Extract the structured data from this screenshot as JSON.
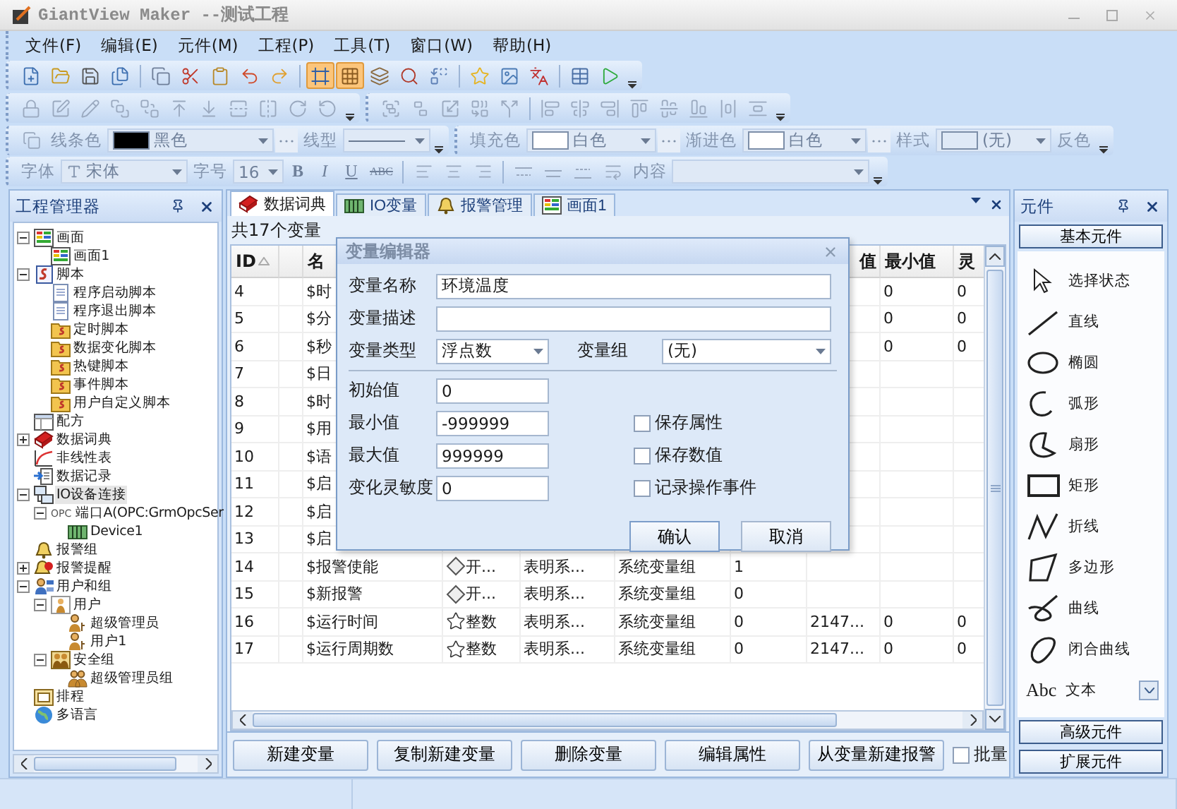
{
  "window": {
    "title": "GiantView Maker --测试工程"
  },
  "menu": [
    "文件(F)",
    "编辑(E)",
    "元件(M)",
    "工程(P)",
    "工具(T)",
    "窗口(W)",
    "帮助(H)"
  ],
  "toolbar_main": [
    {
      "kind": "new",
      "on": false
    },
    {
      "kind": "open",
      "on": false
    },
    {
      "kind": "save",
      "on": false
    },
    {
      "kind": "save-all",
      "on": false
    },
    {
      "kind": "sep"
    },
    {
      "kind": "copy",
      "on": false
    },
    {
      "kind": "cut",
      "on": false
    },
    {
      "kind": "paste",
      "on": false
    },
    {
      "kind": "undo",
      "on": false
    },
    {
      "kind": "redo",
      "on": false
    },
    {
      "kind": "sep"
    },
    {
      "kind": "frame",
      "on": true
    },
    {
      "kind": "grid",
      "on": true
    },
    {
      "kind": "layers",
      "on": false
    },
    {
      "kind": "find",
      "on": false
    },
    {
      "kind": "replace",
      "on": false
    },
    {
      "kind": "sep"
    },
    {
      "kind": "star",
      "on": false
    },
    {
      "kind": "image",
      "on": false
    },
    {
      "kind": "language",
      "on": false
    },
    {
      "kind": "sep"
    },
    {
      "kind": "table",
      "on": false
    },
    {
      "kind": "run",
      "on": false
    }
  ],
  "toolbar_arrange": [
    {
      "kind": "lock"
    },
    {
      "kind": "rect-edit"
    },
    {
      "kind": "pen"
    },
    {
      "kind": "front"
    },
    {
      "kind": "back"
    },
    {
      "kind": "forward"
    },
    {
      "kind": "backward"
    },
    {
      "kind": "flip-v"
    },
    {
      "kind": "flip-h"
    },
    {
      "kind": "rotate-r"
    },
    {
      "kind": "rotate-l"
    }
  ],
  "toolbar_align": [
    {
      "kind": "group"
    },
    {
      "kind": "ungroup"
    },
    {
      "kind": "same-size"
    },
    {
      "kind": "combine"
    },
    {
      "kind": "split"
    },
    {
      "kind": "sep"
    },
    {
      "kind": "align-left"
    },
    {
      "kind": "align-center"
    },
    {
      "kind": "align-right"
    },
    {
      "kind": "align-top"
    },
    {
      "kind": "align-middle"
    },
    {
      "kind": "align-bottom"
    },
    {
      "kind": "space-h"
    },
    {
      "kind": "space-v"
    }
  ],
  "line_toolbar": {
    "line_color_label": "线条色",
    "line_color": {
      "label": "黑色",
      "color": "#000000"
    },
    "line_style_label": "线型",
    "fill_label": "填充色",
    "fill_color": {
      "label": "白色",
      "color": "#ffffff"
    },
    "gradient_label": "渐进色",
    "gradient_color": {
      "label": "白色",
      "color": "#ffffff"
    },
    "style_label": "样式",
    "style_value": "(无)",
    "invert": "反色"
  },
  "font_toolbar": {
    "font_label": "字体",
    "font": "宋体",
    "size_label": "字号",
    "size": "16",
    "bold": "B",
    "italic": "I",
    "underline": "U",
    "strike": "ABC",
    "content_label": "内容"
  },
  "project_panel": {
    "title": "工程管理器",
    "tree": [
      {
        "label": "画面",
        "kind": "screen",
        "expanded": true,
        "selected": false,
        "children": [
          {
            "label": "画面1",
            "kind": "screen",
            "selected": false
          }
        ]
      },
      {
        "label": "脚本",
        "kind": "script",
        "expanded": true,
        "selected": false,
        "children": [
          {
            "label": "程序启动脚本",
            "kind": "doc",
            "selected": false
          },
          {
            "label": "程序退出脚本",
            "kind": "doc",
            "selected": false
          },
          {
            "label": "定时脚本",
            "kind": "script-folder",
            "selected": false
          },
          {
            "label": "数据变化脚本",
            "kind": "script-folder",
            "selected": false
          },
          {
            "label": "热键脚本",
            "kind": "script-folder",
            "selected": false
          },
          {
            "label": "事件脚本",
            "kind": "script-folder",
            "selected": false
          },
          {
            "label": "用户自定义脚本",
            "kind": "script-folder",
            "selected": false
          }
        ]
      },
      {
        "label": "配方",
        "kind": "recipe",
        "selected": false
      },
      {
        "label": "数据词典",
        "kind": "book",
        "expanded": false,
        "selected": false
      },
      {
        "label": "非线性表",
        "kind": "curve",
        "selected": false
      },
      {
        "label": "数据记录",
        "kind": "record",
        "selected": false
      },
      {
        "label": "IO设备连接",
        "kind": "network",
        "expanded": true,
        "selected": true,
        "children": [
          {
            "label": "端口A(OPC:GrmOpcSer",
            "kind": "opc",
            "badge": "OPC",
            "expanded": true,
            "selected": false,
            "children": [
              {
                "label": "Device1",
                "kind": "device",
                "selected": false
              }
            ]
          }
        ]
      },
      {
        "label": "报警组",
        "kind": "bell",
        "selected": false
      },
      {
        "label": "报警提醒",
        "kind": "alarm",
        "expanded": false,
        "selected": false
      },
      {
        "label": "用户和组",
        "kind": "users",
        "expanded": true,
        "selected": false,
        "children": [
          {
            "label": "用户",
            "kind": "user-folder",
            "expanded": true,
            "selected": false,
            "children": [
              {
                "label": "超级管理员",
                "kind": "person",
                "selected": false
              },
              {
                "label": "用户1",
                "kind": "person",
                "selected": false
              }
            ]
          },
          {
            "label": "安全组",
            "kind": "group-folder",
            "expanded": true,
            "selected": false,
            "children": [
              {
                "label": "超级管理员组",
                "kind": "people",
                "selected": false
              }
            ]
          }
        ]
      },
      {
        "label": "排程",
        "kind": "calendar",
        "selected": false
      },
      {
        "label": "多语言",
        "kind": "globe",
        "selected": false
      }
    ]
  },
  "tabs": [
    {
      "label": "数据词典",
      "kind": "book",
      "selected": true
    },
    {
      "label": "IO变量",
      "kind": "device",
      "selected": false
    },
    {
      "label": "报警管理",
      "kind": "bell",
      "selected": false
    },
    {
      "label": "画面1",
      "kind": "screen",
      "selected": false
    }
  ],
  "variable_count": "共17个变量",
  "table": {
    "columns": [
      "ID",
      "",
      "名",
      "",
      "",
      "",
      "",
      "值",
      "最小值",
      "灵"
    ],
    "rows": [
      {
        "id": "4",
        "name": "$时",
        "min": "0",
        "sensitivity": "0"
      },
      {
        "id": "5",
        "name": "$分",
        "min": "0",
        "sensitivity": "0"
      },
      {
        "id": "6",
        "name": "$秒",
        "min": "0",
        "sensitivity": "0"
      },
      {
        "id": "7",
        "name": "$日"
      },
      {
        "id": "8",
        "name": "$时"
      },
      {
        "id": "9",
        "name": "$用"
      },
      {
        "id": "10",
        "name": "$语"
      },
      {
        "id": "11",
        "name": "$启"
      },
      {
        "id": "12",
        "name": "$启"
      },
      {
        "id": "13",
        "name": "$启"
      },
      {
        "id": "14",
        "name": "$报警使能",
        "kind": "switch",
        "type": "开...",
        "desc": "表明系...",
        "group": "系统变量组",
        "init": "1"
      },
      {
        "id": "15",
        "name": "$新报警",
        "kind": "switch",
        "type": "开...",
        "desc": "表明系...",
        "group": "系统变量组",
        "init": "0"
      },
      {
        "id": "16",
        "name": "$运行时间",
        "kind": "integer",
        "type": "整数",
        "desc": "表明系...",
        "group": "系统变量组",
        "init": "0",
        "max": "2147...",
        "min": "0",
        "sensitivity": "0"
      },
      {
        "id": "17",
        "name": "$运行周期数",
        "kind": "integer",
        "type": "整数",
        "desc": "表明系...",
        "group": "系统变量组",
        "init": "0",
        "max": "2147...",
        "min": "0",
        "sensitivity": "0"
      }
    ]
  },
  "actions": [
    "新建变量",
    "复制新建变量",
    "删除变量",
    "编辑属性",
    "从变量新建报警"
  ],
  "batch": {
    "label": "批量",
    "checked": false
  },
  "dialog": {
    "title": "变量编辑器",
    "name_label": "变量名称",
    "name": "环境温度",
    "desc_label": "变量描述",
    "type_label": "变量类型",
    "type": "浮点数",
    "group_label": "变量组",
    "group": "(无)",
    "init_label": "初始值",
    "init": "0",
    "min_label": "最小值",
    "min": "-999999",
    "max_label": "最大值",
    "max": "999999",
    "sens_label": "变化灵敏度",
    "sens": "0",
    "options": [
      {
        "label": "保存属性",
        "checked": false
      },
      {
        "label": "保存数值",
        "checked": false
      },
      {
        "label": "记录操作事件",
        "checked": false
      }
    ],
    "ok": "确认",
    "cancel": "取消"
  },
  "components_panel": {
    "title": "元件",
    "basic": "基本元件",
    "items": [
      {
        "kind": "pointer",
        "label": "选择状态"
      },
      {
        "kind": "line",
        "label": "直线"
      },
      {
        "kind": "ellipse",
        "label": "椭圆"
      },
      {
        "kind": "arc",
        "label": "弧形"
      },
      {
        "kind": "sector",
        "label": "扇形"
      },
      {
        "kind": "rect",
        "label": "矩形"
      },
      {
        "kind": "polyline",
        "label": "折线"
      },
      {
        "kind": "polygon",
        "label": "多边形"
      },
      {
        "kind": "curve",
        "label": "曲线"
      },
      {
        "kind": "closed-curve",
        "label": "闭合曲线"
      },
      {
        "kind": "text",
        "glyph": "Abc",
        "label": "文本"
      }
    ],
    "advanced": "高级元件",
    "extended": "扩展元件"
  }
}
